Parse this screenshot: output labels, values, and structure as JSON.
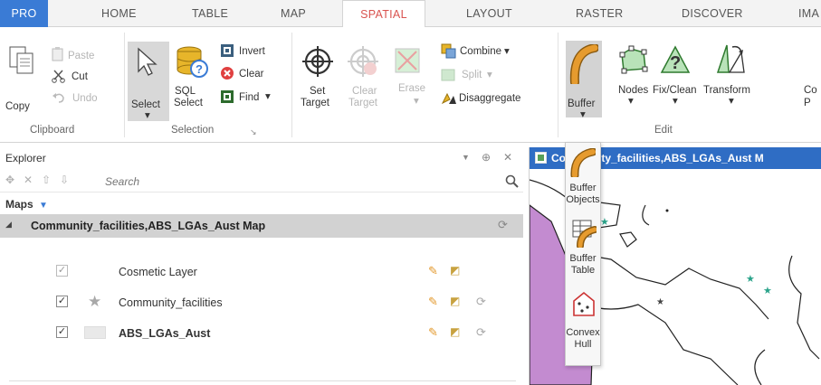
{
  "tabs": {
    "pro": "PRO",
    "home": "HOME",
    "table": "TABLE",
    "map": "MAP",
    "spatial": "SPATIAL",
    "layout": "LAYOUT",
    "raster": "RASTER",
    "discover": "DISCOVER",
    "ima": "IMA"
  },
  "clipboard": {
    "group_label": "Clipboard",
    "copy": "Copy",
    "paste": "Paste",
    "cut": "Cut",
    "undo": "Undo"
  },
  "selection": {
    "group_label": "Selection",
    "select": "Select",
    "sql_select_1": "SQL",
    "sql_select_2": "Select",
    "invert": "Invert",
    "clear": "Clear",
    "find": "Find"
  },
  "combine_group": {
    "set_target_1": "Set",
    "set_target_2": "Target",
    "clear_target_1": "Clear",
    "clear_target_2": "Target",
    "erase": "Erase",
    "combine": "Combine",
    "split": "Split",
    "disaggregate": "Disaggregate"
  },
  "edit": {
    "group_label": "Edit",
    "buffer": "Buffer",
    "nodes": "Nodes",
    "fix_clean": "Fix/Clean",
    "transform": "Transform",
    "co_1": "Co",
    "co_2": "P"
  },
  "buffer_menu": {
    "buffer_objects_1": "Buffer",
    "buffer_objects_2": "Objects",
    "buffer_table_1": "Buffer",
    "buffer_table_2": "Table",
    "convex_hull_1": "Convex",
    "convex_hull_2": "Hull"
  },
  "explorer": {
    "title": "Explorer",
    "search_placeholder": "Search",
    "maps_label": "Maps",
    "map_name": "Community_facilities,ABS_LGAs_Aust Map",
    "layers": [
      {
        "name": "Cosmetic Layer"
      },
      {
        "name": "Community_facilities"
      },
      {
        "name": "ABS_LGAs_Aust"
      }
    ]
  },
  "mapview": {
    "title": "Community_facilities,ABS_LGAs_Aust M"
  },
  "colors": {
    "accent_blue": "#3a7bd5",
    "spatial_tab_red": "#d9534f",
    "map_region": "#c38bd0",
    "buffer_orange": "#d98b1e"
  }
}
